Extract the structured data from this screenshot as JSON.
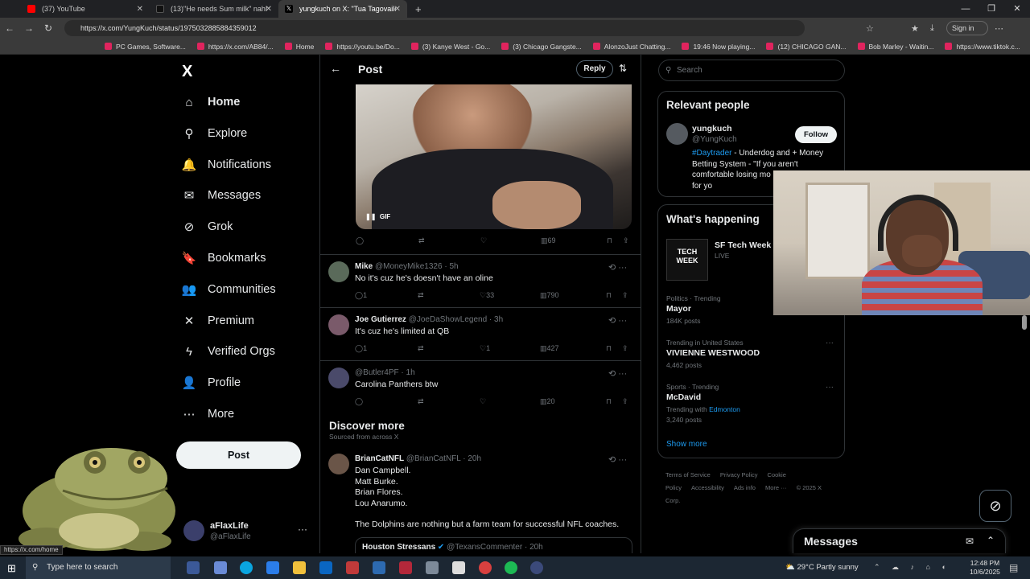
{
  "browser": {
    "tabs": [
      {
        "label": "(37) YouTube",
        "color": "#ff0000"
      },
      {
        "label": "(13)\"He needs Sum milk\" nahh I'm",
        "color": "#000000"
      },
      {
        "label": "yungkuch on X: \"Tua Tagovailoa w",
        "color": "#000000"
      }
    ],
    "url": "https://x.com/YungKuch/status/1975032885884359012",
    "sign_in": "Sign in",
    "bookmarks": [
      "PC Games, Software...",
      "https://x.com/AB84/...",
      "Home",
      "https://youtu.be/Do...",
      "(3) Kanye West - Go...",
      "(3) Chicago Gangste...",
      "AlonzoJust Chatting...",
      "19:46 Now playing...",
      "(12) CHICAGO GAN...",
      "Bob Marley - Waitin...",
      "https://www.tiktok.c..."
    ]
  },
  "sidebar": {
    "logo": "X",
    "items": [
      {
        "label": "Home",
        "icon": "home-icon",
        "glyph": "⌂"
      },
      {
        "label": "Explore",
        "icon": "search-icon",
        "glyph": "⚲"
      },
      {
        "label": "Notifications",
        "icon": "bell-icon",
        "glyph": "🔔"
      },
      {
        "label": "Messages",
        "icon": "envelope-icon",
        "glyph": "✉"
      },
      {
        "label": "Grok",
        "icon": "grok-icon",
        "glyph": "⊘"
      },
      {
        "label": "Bookmarks",
        "icon": "bookmark-icon",
        "glyph": "🔖"
      },
      {
        "label": "Communities",
        "icon": "people-icon",
        "glyph": "👥"
      },
      {
        "label": "Premium",
        "icon": "x-premium-icon",
        "glyph": "✕"
      },
      {
        "label": "Verified Orgs",
        "icon": "lightning-icon",
        "glyph": "ϟ"
      },
      {
        "label": "Profile",
        "icon": "person-icon",
        "glyph": "👤"
      },
      {
        "label": "More",
        "icon": "more-circle-icon",
        "glyph": "⋯"
      }
    ],
    "post_button": "Post",
    "account": {
      "name": "aFlaxLife",
      "handle": "@aFlaxLife"
    }
  },
  "main": {
    "header_title": "Post",
    "reply_button": "Reply",
    "gif_label": "GIF",
    "main_post_actions": {
      "views": "69"
    },
    "replies": [
      {
        "name": "Mike",
        "handle": "@MoneyMike1326",
        "time": "5h",
        "text": "No it's cuz he's doesn't have an oline",
        "replies": "1",
        "likes": "33",
        "views": "790",
        "avatar_color": "#5a6a5a"
      },
      {
        "name": "Joe Gutierrez",
        "handle": "@JoeDaShowLegend",
        "time": "3h",
        "text": "It's cuz he's limited at QB",
        "replies": "1",
        "likes": "1",
        "views": "427",
        "avatar_color": "#7a5a6a"
      },
      {
        "name": "",
        "handle": "@Butler4PF",
        "time": "1h",
        "text": "Carolina Panthers btw",
        "replies": "",
        "likes": "",
        "views": "20",
        "avatar_color": "#4a4a6a"
      }
    ],
    "discover_title": "Discover more",
    "discover_subtitle": "Sourced from across X",
    "discover_post": {
      "name": "BrianCatNFL",
      "handle": "@BrianCatNFL",
      "time": "20h",
      "lines": [
        "Dan Campbell.",
        "Matt Burke.",
        "Brian Flores.",
        "Lou Anarumo."
      ],
      "closing": "The Dolphins are nothing but a farm team for successful NFL coaches."
    },
    "quoted": {
      "name": "Houston Stressans",
      "handle": "@TexansCommenter",
      "time": "20h"
    }
  },
  "right": {
    "search_placeholder": "Search",
    "relevant_title": "Relevant people",
    "person": {
      "name": "yungkuch",
      "handle": "@YungKuch",
      "follow": "Follow",
      "bio_tag": "#Daytrader",
      "bio_rest": " - Underdog and + Money Betting System - \"If you aren't comfortable losing mo market, this isn't for yo"
    },
    "happening_title": "What's happening",
    "event": {
      "name": "SF Tech Week 2",
      "status": "LIVE",
      "logo_text": "TECH WEEK"
    },
    "trends": [
      {
        "meta": "Politics · Trending",
        "name": "Mayor",
        "posts": "184K posts"
      },
      {
        "meta": "Trending in United States",
        "name": "VIVIENNE WESTWOOD",
        "posts": "4,462 posts"
      },
      {
        "meta": "Sports · Trending",
        "name": "McDavid",
        "posts_prefix": "Trending with",
        "posts_link": "Edmonton",
        "posts": "3,240 posts"
      }
    ],
    "show_more": "Show more",
    "footer": [
      "Terms of Service",
      "Privacy Policy",
      "Cookie Policy",
      "Accessibility",
      "Ads info",
      "More ···",
      "© 2025 X Corp."
    ]
  },
  "messages_drawer": {
    "title": "Messages"
  },
  "status_url": "https://x.com/home",
  "taskbar": {
    "search_placeholder": "Type here to search",
    "weather": "29°C  Partly sunny",
    "time": "12:48 PM",
    "date": "10/6/2025"
  }
}
